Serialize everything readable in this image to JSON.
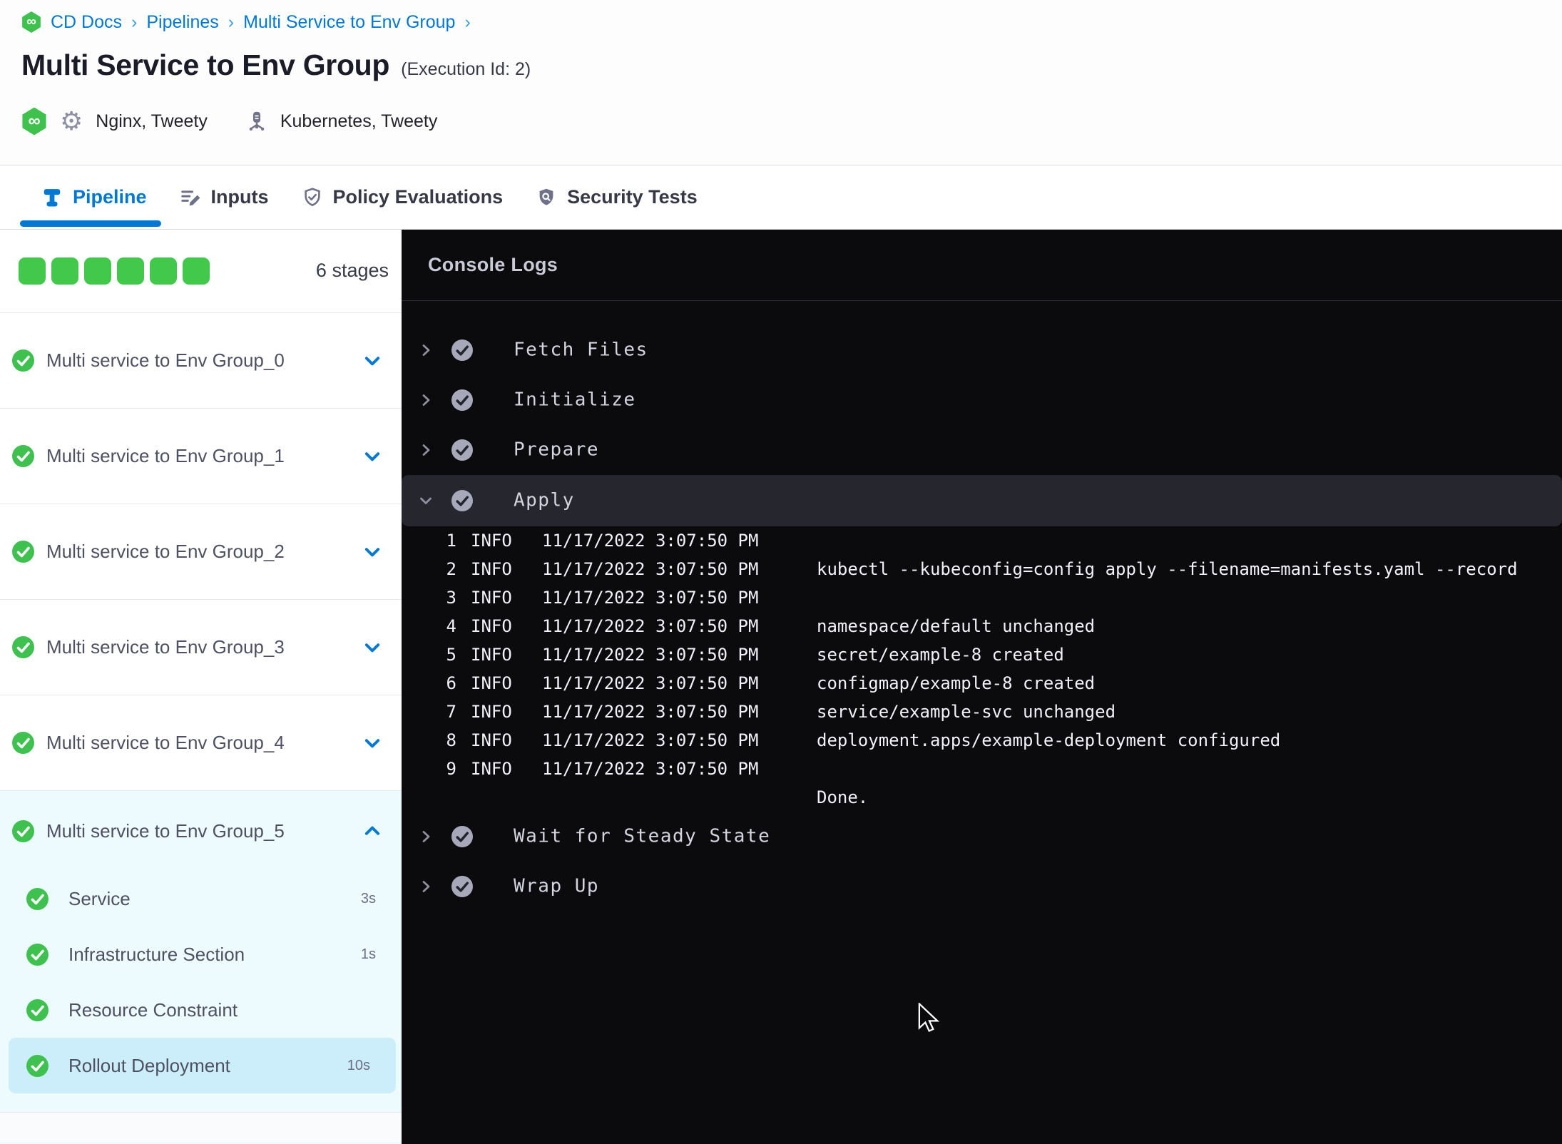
{
  "breadcrumb": {
    "separator": "›",
    "items": [
      {
        "label": "CD Docs"
      },
      {
        "label": "Pipelines"
      },
      {
        "label": "Multi Service to Env Group"
      }
    ]
  },
  "page": {
    "title": "Multi Service to Env Group",
    "execution_id": "(Execution Id: 2)"
  },
  "context": {
    "services": "Nginx, Tweety",
    "infrastructure": "Kubernetes, Tweety",
    "logo_glyph": "∞"
  },
  "tabs": [
    {
      "label": "Pipeline",
      "icon": "pipeline-icon",
      "active": true
    },
    {
      "label": "Inputs",
      "icon": "inputs-icon",
      "active": false
    },
    {
      "label": "Policy Evaluations",
      "icon": "shield-check-icon",
      "active": false
    },
    {
      "label": "Security Tests",
      "icon": "shield-search-icon",
      "active": false
    }
  ],
  "stage_summary": {
    "squares": 6,
    "label": "6 stages"
  },
  "stages": [
    {
      "name": "Multi service to Env Group_0",
      "status": "success",
      "expanded": false
    },
    {
      "name": "Multi service to Env Group_1",
      "status": "success",
      "expanded": false
    },
    {
      "name": "Multi service to Env Group_2",
      "status": "success",
      "expanded": false
    },
    {
      "name": "Multi service to Env Group_3",
      "status": "success",
      "expanded": false
    },
    {
      "name": "Multi service to Env Group_4",
      "status": "success",
      "expanded": false
    },
    {
      "name": "Multi service to Env Group_5",
      "status": "success",
      "expanded": true,
      "steps": [
        {
          "name": "Service",
          "duration": "3s",
          "selected": false
        },
        {
          "name": "Infrastructure Section",
          "duration": "1s",
          "selected": false
        },
        {
          "name": "Resource Constraint",
          "duration": "",
          "selected": false
        },
        {
          "name": "Rollout Deployment",
          "duration": "10s",
          "selected": true
        }
      ]
    }
  ],
  "console": {
    "title": "Console Logs",
    "steps": [
      {
        "name": "Fetch Files",
        "status": "success",
        "expanded": false
      },
      {
        "name": "Initialize",
        "status": "success",
        "expanded": false
      },
      {
        "name": "Prepare",
        "status": "success",
        "expanded": false
      },
      {
        "name": "Apply",
        "status": "success",
        "expanded": true,
        "logs": [
          {
            "n": "1",
            "level": "INFO",
            "time": "11/17/2022 3:07:50 PM",
            "message": ""
          },
          {
            "n": "2",
            "level": "INFO",
            "time": "11/17/2022 3:07:50 PM",
            "message": "kubectl --kubeconfig=config apply --filename=manifests.yaml --record"
          },
          {
            "n": "3",
            "level": "INFO",
            "time": "11/17/2022 3:07:50 PM",
            "message": ""
          },
          {
            "n": "4",
            "level": "INFO",
            "time": "11/17/2022 3:07:50 PM",
            "message": "namespace/default unchanged"
          },
          {
            "n": "5",
            "level": "INFO",
            "time": "11/17/2022 3:07:50 PM",
            "message": "secret/example-8 created"
          },
          {
            "n": "6",
            "level": "INFO",
            "time": "11/17/2022 3:07:50 PM",
            "message": "configmap/example-8 created"
          },
          {
            "n": "7",
            "level": "INFO",
            "time": "11/17/2022 3:07:50 PM",
            "message": "service/example-svc unchanged"
          },
          {
            "n": "8",
            "level": "INFO",
            "time": "11/17/2022 3:07:50 PM",
            "message": "deployment.apps/example-deployment configured"
          },
          {
            "n": "9",
            "level": "INFO",
            "time": "11/17/2022 3:07:50 PM",
            "message": ""
          },
          {
            "n": "",
            "level": "",
            "time": "",
            "message": "Done."
          }
        ]
      },
      {
        "name": "Wait for Steady State",
        "status": "success",
        "expanded": false
      },
      {
        "name": "Wrap Up",
        "status": "success",
        "expanded": false
      }
    ]
  },
  "colors": {
    "accent_blue": "#0278d5",
    "success_green": "#42c94c",
    "console_bg": "#0b0b0e",
    "console_band": "#26262f",
    "expanded_stage_bg": "#edfafe",
    "selected_step_bg": "#cbeefa"
  }
}
